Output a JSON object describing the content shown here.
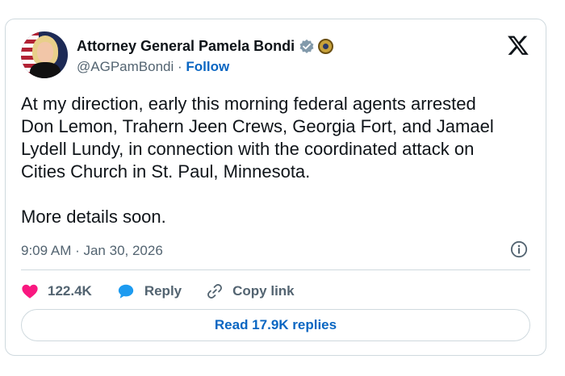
{
  "author": {
    "name": "Attorney General Pamela Bondi",
    "handle": "@AGPamBondi",
    "separator": "·",
    "follow_label": "Follow"
  },
  "tweet": {
    "text": "At my direction, early this morning federal agents arrested\nDon Lemon, Trahern Jeen Crews, Georgia Fort, and Jamael\nLydell Lundy, in connection with the coordinated attack on\nCities Church in St. Paul, Minnesota.\n\nMore details soon.",
    "timestamp": "9:09 AM · Jan 30, 2026"
  },
  "actions": {
    "like_count": "122.4K",
    "reply_label": "Reply",
    "copy_link_label": "Copy link",
    "read_replies_label": "Read 17.9K replies"
  },
  "icons": {
    "verified": "verified-badge-icon",
    "seal": "government-seal-icon",
    "logo": "x-logo-icon",
    "info": "info-icon",
    "like": "heart-icon",
    "reply": "speech-bubble-icon",
    "copy": "link-icon"
  },
  "colors": {
    "accent": "#0a66c2",
    "like": "#f91880",
    "reply": "#1d9bf0",
    "muted": "#536471"
  }
}
